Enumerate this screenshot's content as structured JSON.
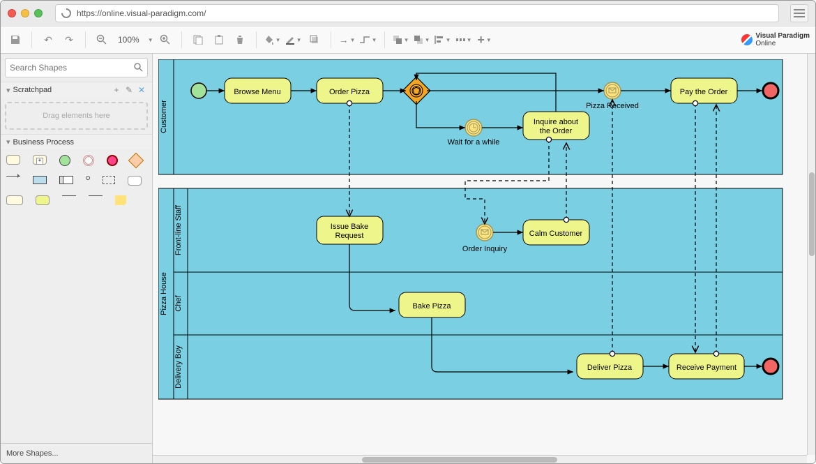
{
  "url": "https://online.visual-paradigm.com/",
  "logo": {
    "brand": "Visual Paradigm",
    "sub": "Online"
  },
  "toolbar": {
    "zoom": "100%"
  },
  "search": {
    "placeholder": "Search Shapes"
  },
  "sidebar": {
    "scratchpad_title": "Scratchpad",
    "scratchpad_hint": "Drag elements here",
    "palette_title": "Business Process",
    "more_shapes": "More Shapes..."
  },
  "diagram": {
    "pools": [
      {
        "name": "Customer",
        "lanes": [
          "Customer"
        ]
      },
      {
        "name": "Pizza House",
        "lanes": [
          "Front-line Staff",
          "Chef",
          "Delivery Boy"
        ]
      }
    ],
    "tasks": {
      "browse_menu": "Browse Menu",
      "order_pizza": "Order Pizza",
      "inquire": "Inquire about the Order",
      "pay_order": "Pay the Order",
      "issue_bake": "Issue Bake Request",
      "calm_customer": "Calm Customer",
      "bake_pizza": "Bake Pizza",
      "deliver_pizza": "Deliver Pizza",
      "receive_payment": "Receive Payment"
    },
    "events": {
      "wait_label": "Wait for a while",
      "pizza_received": "Pizza Received",
      "order_inquiry": "Order Inquiry"
    },
    "chart_data": {
      "type": "bpmn",
      "pools": [
        {
          "id": "p_customer",
          "name": "Customer",
          "lanes": [
            {
              "id": "l_cust",
              "name": "Customer"
            }
          ]
        },
        {
          "id": "p_pizzahouse",
          "name": "Pizza House",
          "lanes": [
            {
              "id": "l_front",
              "name": "Front-line Staff"
            },
            {
              "id": "l_chef",
              "name": "Chef"
            },
            {
              "id": "l_deliv",
              "name": "Delivery Boy"
            }
          ]
        }
      ],
      "nodes": [
        {
          "id": "start_cust",
          "type": "startEvent",
          "lane": "l_cust"
        },
        {
          "id": "t_browse",
          "type": "task",
          "label": "Browse Menu",
          "lane": "l_cust"
        },
        {
          "id": "t_order",
          "type": "task",
          "label": "Order Pizza",
          "lane": "l_cust"
        },
        {
          "id": "g1",
          "type": "eventBasedGateway",
          "lane": "l_cust"
        },
        {
          "id": "e_wait",
          "type": "intermediateTimerEvent",
          "label": "Wait for a while",
          "lane": "l_cust"
        },
        {
          "id": "t_inquire",
          "type": "task",
          "label": "Inquire about the Order",
          "lane": "l_cust"
        },
        {
          "id": "e_received",
          "type": "intermediateMessageCatchEvent",
          "label": "Pizza Received",
          "lane": "l_cust"
        },
        {
          "id": "t_pay",
          "type": "task",
          "label": "Pay the Order",
          "lane": "l_cust"
        },
        {
          "id": "end_cust",
          "type": "endEvent",
          "lane": "l_cust"
        },
        {
          "id": "t_issue",
          "type": "task",
          "label": "Issue Bake Request",
          "lane": "l_front"
        },
        {
          "id": "e_inquiry",
          "type": "intermediateMessageCatchEvent",
          "label": "Order Inquiry",
          "lane": "l_front"
        },
        {
          "id": "t_calm",
          "type": "task",
          "label": "Calm Customer",
          "lane": "l_front"
        },
        {
          "id": "t_bake",
          "type": "task",
          "label": "Bake Pizza",
          "lane": "l_chef"
        },
        {
          "id": "t_deliver",
          "type": "task",
          "label": "Deliver Pizza",
          "lane": "l_deliv"
        },
        {
          "id": "t_receive",
          "type": "task",
          "label": "Receive Payment",
          "lane": "l_deliv"
        },
        {
          "id": "end_deliv",
          "type": "endEvent",
          "lane": "l_deliv"
        }
      ],
      "sequenceFlows": [
        {
          "from": "start_cust",
          "to": "t_browse"
        },
        {
          "from": "t_browse",
          "to": "t_order"
        },
        {
          "from": "t_order",
          "to": "g1"
        },
        {
          "from": "g1",
          "to": "e_received"
        },
        {
          "from": "g1",
          "to": "e_wait"
        },
        {
          "from": "e_wait",
          "to": "t_inquire"
        },
        {
          "from": "t_inquire",
          "to": "g1"
        },
        {
          "from": "e_received",
          "to": "t_pay"
        },
        {
          "from": "t_pay",
          "to": "end_cust"
        },
        {
          "from": "t_issue",
          "to": "t_bake"
        },
        {
          "from": "e_inquiry",
          "to": "t_calm"
        },
        {
          "from": "t_bake",
          "to": "t_deliver"
        },
        {
          "from": "t_deliver",
          "to": "t_receive"
        },
        {
          "from": "t_receive",
          "to": "end_deliv"
        }
      ],
      "messageFlows": [
        {
          "from": "t_order",
          "to": "t_issue"
        },
        {
          "from": "t_inquire",
          "to": "e_inquiry"
        },
        {
          "from": "t_calm",
          "to": "t_inquire"
        },
        {
          "from": "t_deliver",
          "to": "e_received"
        },
        {
          "from": "t_pay",
          "to": "t_receive"
        },
        {
          "from": "t_receive",
          "to": "t_pay"
        }
      ]
    }
  }
}
